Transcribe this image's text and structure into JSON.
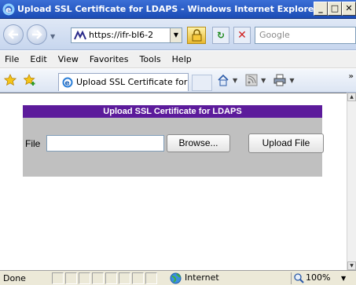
{
  "window": {
    "title": "Upload SSL Certificate for LDAPS - Windows Internet Explorer",
    "minimize": "_",
    "maximize": "□",
    "close": "✕"
  },
  "address": {
    "url": "https://ifr-bl6-2",
    "search_placeholder": "Google"
  },
  "menu": [
    "File",
    "Edit",
    "View",
    "Favorites",
    "Tools",
    "Help"
  ],
  "tab": {
    "title": "Upload SSL Certificate for ..."
  },
  "page": {
    "header": "Upload SSL Certificate for LDAPS",
    "file_label": "File",
    "browse_label": "Browse...",
    "upload_label": "Upload File"
  },
  "status": {
    "text": "Done",
    "zone": "Internet",
    "zoom": "100%"
  },
  "icons": {
    "browser": "ie-logo-icon",
    "back": "back-arrow-icon",
    "forward": "forward-arrow-icon",
    "lock": "lock-icon",
    "refresh": "refresh-icon",
    "stop": "stop-icon",
    "favorites": "star-icon",
    "add_favorites": "add-favorites-icon",
    "home": "home-icon",
    "feeds": "feeds-icon",
    "print": "print-icon",
    "globe": "globe-icon",
    "zoom": "zoom-icon"
  },
  "colors": {
    "title_bar": "#1c4db6",
    "panel_header": "#5c1b9b",
    "panel_bg": "#c0c0c0"
  }
}
